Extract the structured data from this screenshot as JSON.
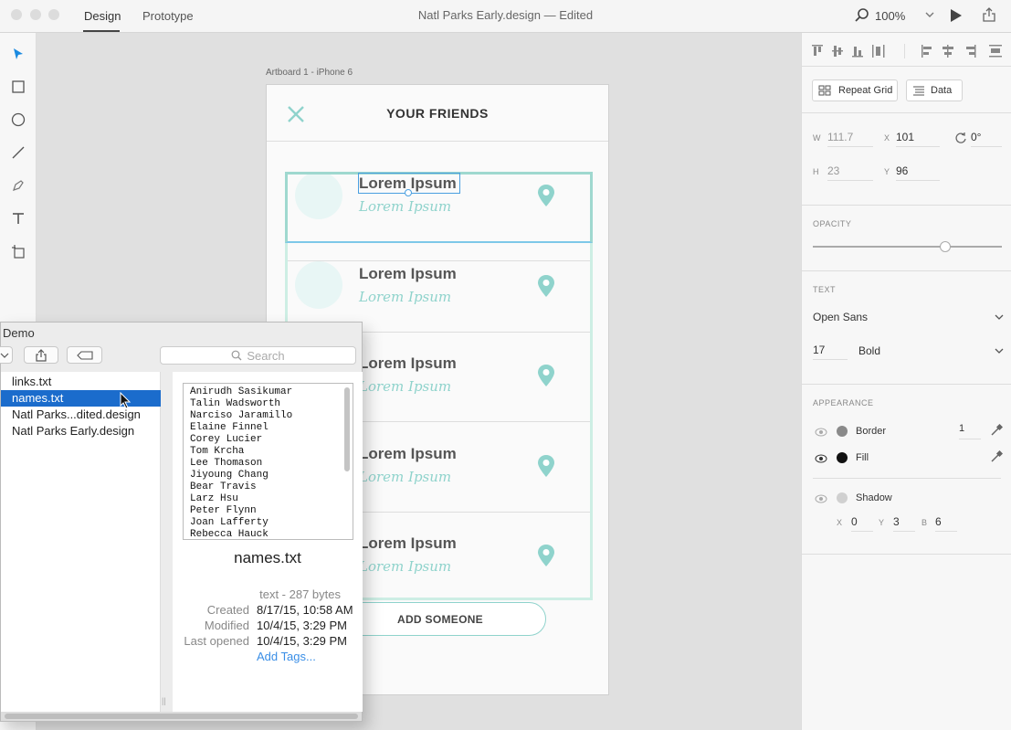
{
  "window": {
    "tabs": [
      "Design",
      "Prototype"
    ],
    "title": "Natl Parks Early.design — Edited",
    "zoom": "100%"
  },
  "canvas": {
    "artboard_label": "Artboard 1 - iPhone 6",
    "header_title": "YOUR FRIENDS",
    "rows": [
      {
        "name": "Lorem Ipsum",
        "sub": "Lorem Ipsum"
      },
      {
        "name": "Lorem Ipsum",
        "sub": "Lorem Ipsum"
      },
      {
        "name": "Lorem Ipsum",
        "sub": "Lorem Ipsum"
      },
      {
        "name": "Lorem Ipsum",
        "sub": "Lorem Ipsum"
      },
      {
        "name": "Lorem Ipsum",
        "sub": "Lorem Ipsum"
      }
    ],
    "add_button": "ADD SOMEONE",
    "accent": "#8fd3cc"
  },
  "inspector": {
    "repeat_grid": "Repeat Grid",
    "data": "Data",
    "w_label": "W",
    "w": "111.7",
    "x_label": "X",
    "x": "101",
    "rotation": "0°",
    "h_label": "H",
    "h": "23",
    "y_label": "Y",
    "y": "96",
    "opacity_label": "OPACITY",
    "opacity_value": 0.7,
    "text_label": "TEXT",
    "font": "Open Sans",
    "font_size": "17",
    "font_weight": "Bold",
    "appearance_label": "APPEARANCE",
    "border_label": "Border",
    "border_value": "1",
    "fill_label": "Fill",
    "shadow_label": "Shadow",
    "shadow_x_label": "X",
    "shadow_x": "0",
    "shadow_y_label": "Y",
    "shadow_y": "3",
    "shadow_b_label": "B",
    "shadow_b": "6",
    "border_color": "#8a8a8a",
    "fill_color": "#111111"
  },
  "finder": {
    "title": "Demo",
    "search_placeholder": "Search",
    "files": [
      "links.txt",
      "names.txt",
      "Natl Parks...dited.design",
      "Natl Parks Early.design"
    ],
    "selected_index": 1,
    "preview_lines": [
      "Anirudh Sasikumar",
      "Talin Wadsworth",
      "Narciso Jaramillo",
      "Elaine Finnel",
      "Corey Lucier",
      "Tom Krcha",
      "Lee Thomason",
      "Jiyoung Chang",
      "Bear Travis",
      "Larz Hsu",
      "Peter Flynn",
      "Joan Lafferty",
      "Rebecca Hauck"
    ],
    "preview_name": "names.txt",
    "kind": "text - 287 bytes",
    "created_label": "Created",
    "created": "8/17/15, 10:58 AM",
    "modified_label": "Modified",
    "modified": "10/4/15, 3:29 PM",
    "opened_label": "Last opened",
    "opened": "10/4/15, 3:29 PM",
    "add_tags": "Add Tags..."
  }
}
